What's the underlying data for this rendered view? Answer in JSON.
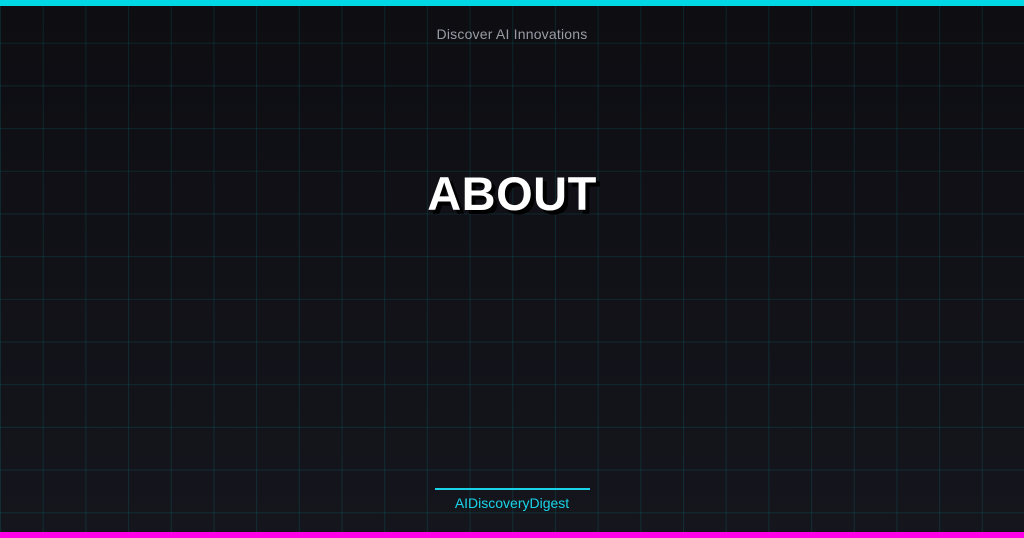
{
  "header": {
    "tagline": "Discover AI Innovations"
  },
  "main": {
    "title": "ABOUT"
  },
  "footer": {
    "brand": "AIDiscoveryDigest"
  },
  "colors": {
    "accent_top": "#00d8e6",
    "accent_bottom": "#ff00e6",
    "brand": "#19d3e8",
    "background": "#111218"
  }
}
